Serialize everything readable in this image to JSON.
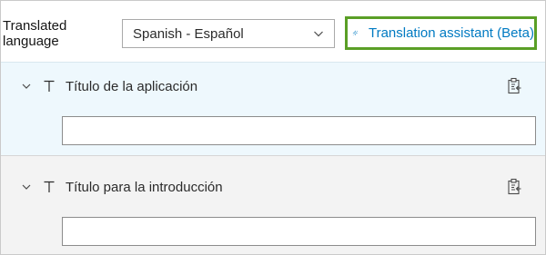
{
  "header": {
    "translated_language_label": "Translated language",
    "language_select": {
      "value": "Spanish - Español"
    },
    "assistant_button": {
      "label": "Translation assistant (Beta)"
    }
  },
  "fields": [
    {
      "label": "Título de la aplicación",
      "value": ""
    },
    {
      "label": "Título para la introducción",
      "value": ""
    }
  ],
  "icons": {
    "collapse": "chevron-down-icon",
    "text_type": "text-t-icon",
    "clipboard": "clipboard-paste-icon",
    "sparkle": "sparkle-icon",
    "select_arrow": "chevron-down-icon"
  },
  "colors": {
    "accent_blue": "#007ac2",
    "highlight_green": "#5a9f26",
    "section_active_bg": "#eef8fd",
    "section_bg": "#f3f3f3"
  }
}
